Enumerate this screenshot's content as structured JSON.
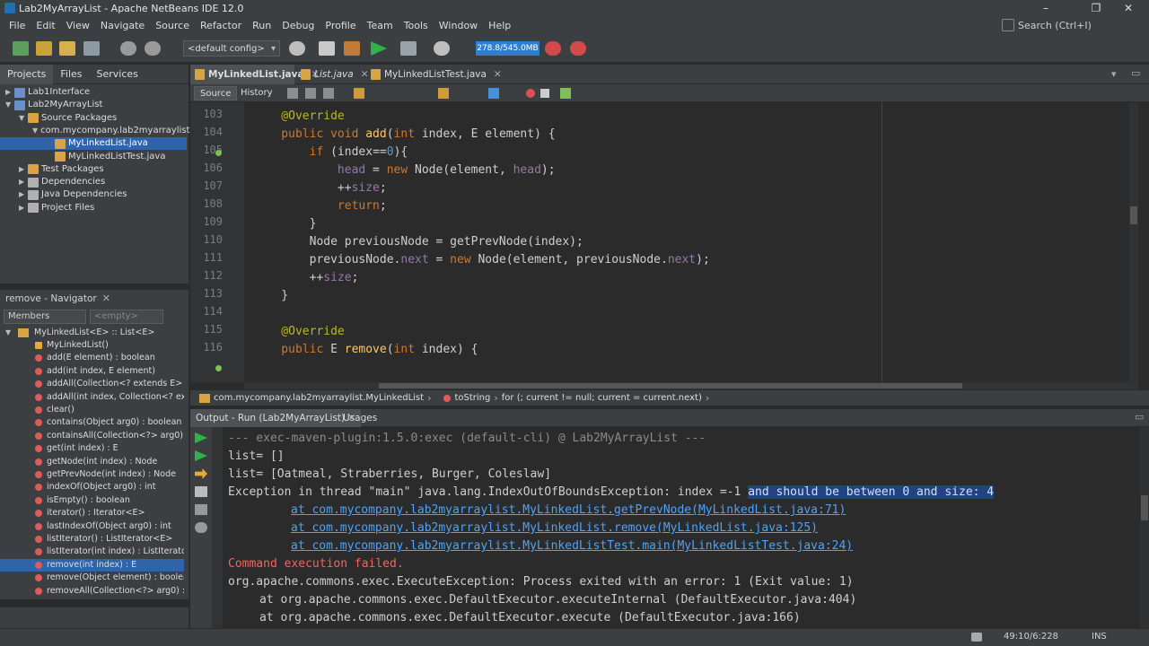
{
  "window": {
    "title": "Lab2MyArrayList - Apache NetBeans IDE 12.0",
    "minimize": "–",
    "maximize": "❐",
    "close": "✕"
  },
  "menu": [
    "File",
    "Edit",
    "View",
    "Navigate",
    "Source",
    "Refactor",
    "Run",
    "Debug",
    "Profile",
    "Team",
    "Tools",
    "Window",
    "Help"
  ],
  "search": {
    "placeholder": "Search (Ctrl+I)"
  },
  "toolbar": {
    "config": "<default config>",
    "memory": "278.8/545.0MB"
  },
  "projects": {
    "tabs": [
      "Projects",
      "Files",
      "Services"
    ],
    "tree": [
      {
        "label": "Lab1Interface",
        "level": 0,
        "arrow": "▶"
      },
      {
        "label": "Lab2MyArrayList",
        "level": 0,
        "arrow": "▼"
      },
      {
        "label": "Source Packages",
        "level": 1,
        "arrow": "▼"
      },
      {
        "label": "com.mycompany.lab2myarraylist",
        "level": 2,
        "arrow": "▼"
      },
      {
        "label": "MyLinkedList.java",
        "level": 3,
        "arrow": "",
        "selected": true
      },
      {
        "label": "MyLinkedListTest.java",
        "level": 3,
        "arrow": ""
      },
      {
        "label": "Test Packages",
        "level": 1,
        "arrow": "▶"
      },
      {
        "label": "Dependencies",
        "level": 1,
        "arrow": "▶"
      },
      {
        "label": "Java Dependencies",
        "level": 1,
        "arrow": "▶"
      },
      {
        "label": "Project Files",
        "level": 1,
        "arrow": "▶"
      }
    ]
  },
  "navigator": {
    "title": "remove - Navigator",
    "filter_label": "Members",
    "filter_placeholder": "<empty>",
    "root": "MyLinkedList<E> :: List<E>",
    "members": [
      "MyLinkedList()",
      "add(E element) : boolean",
      "add(int index, E element)",
      "addAll(Collection<? extends E> arg0",
      "addAll(int index, Collection<? exter",
      "clear()",
      "contains(Object arg0) : boolean",
      "containsAll(Collection<?> arg0) : b",
      "get(int index) : E",
      "getNode(int index) : Node",
      "getPrevNode(int index) : Node",
      "indexOf(Object arg0) : int",
      "isEmpty() : boolean",
      "iterator() : Iterator<E>",
      "lastIndexOf(Object arg0) : int",
      "listIterator() : ListIterator<E>",
      "listIterator(int index) : ListIterator<E>",
      "remove(int index) : E",
      "remove(Object element) : boolean",
      "removeAll(Collection<?> arg0) : bc"
    ],
    "selected_index": 17
  },
  "editor": {
    "tabs": [
      "MyLinkedList.java",
      "List.java",
      "MyLinkedListTest.java"
    ],
    "active_tab": 0,
    "subtabs": [
      "Source",
      "History"
    ],
    "lines": [
      "103",
      "104",
      "105",
      "106",
      "107",
      "108",
      "109",
      "110",
      "111",
      "112",
      "113",
      "114",
      "115",
      "116"
    ],
    "code": [
      [
        {
          "t": "        ",
          "c": ""
        }
      ],
      [
        {
          "t": "    @Override",
          "c": "an"
        }
      ],
      [
        {
          "t": "    public void ",
          "c": "kw"
        },
        {
          "t": "add",
          "c": "mt"
        },
        {
          "t": "(",
          "c": ""
        },
        {
          "t": "int",
          "c": "kw"
        },
        {
          "t": " index, E element) {",
          "c": ""
        }
      ],
      [
        {
          "t": "        if",
          "c": "kw"
        },
        {
          "t": " (index==",
          "c": ""
        },
        {
          "t": "0",
          "c": "nm"
        },
        {
          "t": "){",
          "c": ""
        }
      ],
      [
        {
          "t": "            ",
          "c": ""
        },
        {
          "t": "head",
          "c": "fd"
        },
        {
          "t": " = ",
          "c": ""
        },
        {
          "t": "new",
          "c": "kw"
        },
        {
          "t": " Node(element, ",
          "c": ""
        },
        {
          "t": "head",
          "c": "fd"
        },
        {
          "t": ");",
          "c": ""
        }
      ],
      [
        {
          "t": "            ++",
          "c": ""
        },
        {
          "t": "size",
          "c": "fd"
        },
        {
          "t": ";",
          "c": ""
        }
      ],
      [
        {
          "t": "            return",
          "c": "kw"
        },
        {
          "t": ";",
          "c": ""
        }
      ],
      [
        {
          "t": "        }",
          "c": ""
        }
      ],
      [
        {
          "t": "        Node previousNode = getPrevNode(index);",
          "c": ""
        }
      ],
      [
        {
          "t": "        previousNode.",
          "c": ""
        },
        {
          "t": "next",
          "c": "fd"
        },
        {
          "t": " = ",
          "c": ""
        },
        {
          "t": "new",
          "c": "kw"
        },
        {
          "t": " Node(element, previousNode.",
          "c": ""
        },
        {
          "t": "next",
          "c": "fd"
        },
        {
          "t": ");",
          "c": ""
        }
      ],
      [
        {
          "t": "        ++",
          "c": ""
        },
        {
          "t": "size",
          "c": "fd"
        },
        {
          "t": ";",
          "c": ""
        }
      ],
      [
        {
          "t": "    }",
          "c": ""
        }
      ],
      [
        {
          "t": "",
          "c": ""
        }
      ],
      [
        {
          "t": "    @Override",
          "c": "an"
        }
      ],
      [
        {
          "t": "    public ",
          "c": "kw"
        },
        {
          "t": "E ",
          "c": ""
        },
        {
          "t": "remove",
          "c": "mt"
        },
        {
          "t": "(",
          "c": ""
        },
        {
          "t": "int",
          "c": "kw"
        },
        {
          "t": " index) {",
          "c": ""
        }
      ]
    ],
    "breadcrumbs": [
      "com.mycompany.lab2myarraylist.MyLinkedList",
      "toString",
      "for (; current != null; current = current.next)"
    ]
  },
  "output": {
    "tabs": [
      "Output - Run (Lab2MyArrayList)",
      "Usages"
    ],
    "lines": [
      {
        "text": "--- exec-maven-plugin:1.5.0:exec (default-cli) @ Lab2MyArrayList ---",
        "style": "dim",
        "indent": 0
      },
      {
        "text": "list= []",
        "style": "",
        "indent": 0
      },
      {
        "text": "list= [Oatmeal, Straberries, Burger, Coleslaw]",
        "style": "",
        "indent": 0
      },
      {
        "text": "Exception in thread \"main\" java.lang.IndexOutOfBoundsException: index =-1 ",
        "style": "",
        "indent": 0,
        "highlight": "and should be between 0 and size: 4"
      },
      {
        "text": "at com.mycompany.lab2myarraylist.MyLinkedList.getPrevNode(MyLinkedList.java:71)",
        "style": "link",
        "indent": 70
      },
      {
        "text": "at com.mycompany.lab2myarraylist.MyLinkedList.remove(MyLinkedList.java:125)",
        "style": "link",
        "indent": 70
      },
      {
        "text": "at com.mycompany.lab2myarraylist.MyLinkedListTest.main(MyLinkedListTest.java:24)",
        "style": "link",
        "indent": 70
      },
      {
        "text": "Command execution failed.",
        "style": "red",
        "indent": 0
      },
      {
        "text": "org.apache.commons.exec.ExecuteException: Process exited with an error: 1 (Exit value: 1)",
        "style": "",
        "indent": 0
      },
      {
        "text": "at org.apache.commons.exec.DefaultExecutor.executeInternal (DefaultExecutor.java:404)",
        "style": "",
        "indent": 35
      },
      {
        "text": "at org.apache.commons.exec.DefaultExecutor.execute (DefaultExecutor.java:166)",
        "style": "",
        "indent": 35
      }
    ]
  },
  "status": {
    "position": "49:10/6:228",
    "mode": "INS"
  },
  "colors": {
    "accent": "#2f65a8",
    "memory": "#2f7fd1",
    "error": "#ff5f5f",
    "link": "#4aa3ff"
  }
}
